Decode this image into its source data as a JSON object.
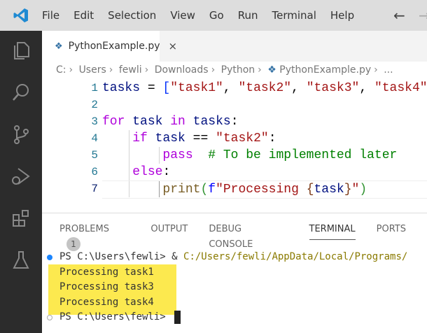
{
  "menu": [
    "File",
    "Edit",
    "Selection",
    "View",
    "Go",
    "Run",
    "Terminal",
    "Help"
  ],
  "tab": {
    "title": "PythonExample.py",
    "close": "×"
  },
  "breadcrumb": [
    "C:",
    "Users",
    "fewli",
    "Downloads",
    "Python",
    "PythonExample.py",
    "..."
  ],
  "code": {
    "line_numbers": [
      "1",
      "2",
      "3",
      "4",
      "5",
      "6",
      "7"
    ]
  },
  "panel": {
    "tabs": [
      "PROBLEMS",
      "OUTPUT",
      "DEBUG CONSOLE",
      "TERMINAL",
      "PORTS"
    ],
    "problems_count": "1",
    "active_tab": "TERMINAL"
  },
  "terminal": {
    "prompt1": "PS C:\\Users\\fewli> ",
    "command_amp": "& ",
    "command_path": "C:/Users/fewli/AppData/Local/Programs/",
    "output": [
      "Processing task1",
      "Processing task3",
      "Processing task4"
    ],
    "prompt2": "PS C:\\Users\\fewli> ",
    "highlight_color": "#fce94f"
  }
}
